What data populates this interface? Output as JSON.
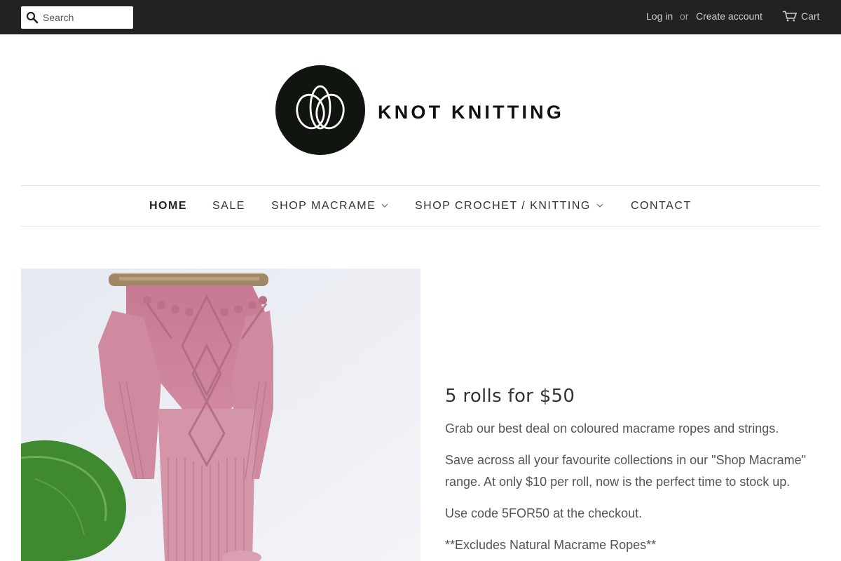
{
  "topbar": {
    "search_placeholder": "Search",
    "login": "Log in",
    "or": "or",
    "create_account": "Create account",
    "cart": "Cart"
  },
  "brand": {
    "name": "KNOT KNITTING"
  },
  "nav": {
    "items": [
      {
        "label": "HOME",
        "active": true
      },
      {
        "label": "SALE"
      },
      {
        "label": "SHOP MACRAME",
        "dropdown": true
      },
      {
        "label": "SHOP CROCHET / KNITTING",
        "dropdown": true
      },
      {
        "label": "CONTACT"
      }
    ]
  },
  "promo": {
    "title": "5 rolls for $50",
    "p1": "Grab our best deal on coloured macrame ropes and strings.",
    "p2": "Save across all your favourite collections in our \"Shop Macrame\" range. At only $10 per roll, now is the perfect time to stock up.",
    "p3": "Use code 5FOR50 at the checkout.",
    "p4": "**Excludes Natural Macrame Ropes**"
  },
  "colors": {
    "topbar_bg": "#222222",
    "macrame_pink": "#c97a91",
    "leaf_green": "#3f8a2e"
  }
}
